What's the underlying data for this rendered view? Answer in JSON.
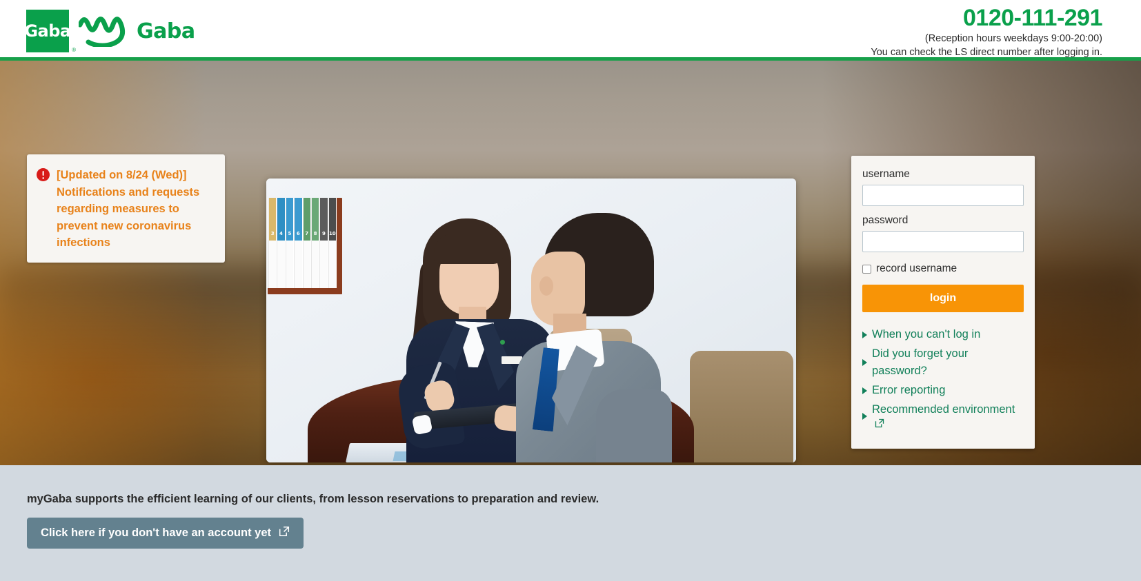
{
  "header": {
    "logo": {
      "mark_text": "Gaba",
      "registered_mark": "®",
      "wordmark_text": "Gaba",
      "my_squiggle_name": "my-squiggle-logo"
    },
    "phone_number": "0120-111-291",
    "reception_hours": "(Reception hours weekdays 9:00-20:00)",
    "ls_note": "You can check the LS direct number after logging in.",
    "accent_green": "#0aa04b"
  },
  "notice": {
    "icon": "alert-exclamation-icon",
    "text": "[Updated on 8/24 (Wed)] Notifications and requests regarding measures to prevent new coronavirus infections",
    "text_color": "#e8821a"
  },
  "hero_photo": {
    "alt": "Counselor in navy suit speaking with a client in a grey suit at a wooden table",
    "binders": [
      {
        "num": "3",
        "color": "#d9b86a"
      },
      {
        "num": "4",
        "color": "#2e8fc4"
      },
      {
        "num": "5",
        "color": "#3a9ad0"
      },
      {
        "num": "6",
        "color": "#3a9ad0"
      },
      {
        "num": "7",
        "color": "#5f9e6a"
      },
      {
        "num": "8",
        "color": "#6aa876"
      },
      {
        "num": "9",
        "color": "#5c5c5c"
      },
      {
        "num": "10",
        "color": "#4d4d4d"
      }
    ]
  },
  "login": {
    "username_label": "username",
    "username_value": "",
    "username_placeholder": "",
    "password_label": "password",
    "password_value": "",
    "password_placeholder": "",
    "remember_label": "record username",
    "remember_checked": false,
    "login_label": "login",
    "login_button_color": "#f89406",
    "link_color": "#12805a",
    "links": [
      {
        "label": "When you can't log in",
        "external": false
      },
      {
        "label": "Did you forget your password?",
        "external": false
      },
      {
        "label": "Error reporting",
        "external": false
      },
      {
        "label": "Recommended environment",
        "external": true
      }
    ]
  },
  "footer": {
    "lead": "myGaba supports the efficient learning of our clients, from lesson reservations to preparation and review.",
    "cta_label": "Click here if you don't have an account yet",
    "cta_icon": "external-link-icon",
    "background": "#d2d9e0",
    "cta_color": "#63818f"
  }
}
